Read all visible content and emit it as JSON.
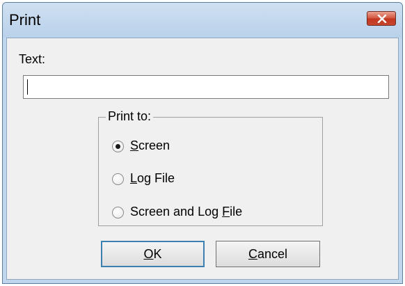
{
  "window": {
    "title": "Print"
  },
  "text_field": {
    "label": "Text:",
    "value": ""
  },
  "print_to": {
    "legend": "Print to:",
    "options": [
      {
        "mnemonic": "S",
        "rest": "creen",
        "selected": true
      },
      {
        "mnemonic": "L",
        "rest": "og File",
        "selected": false
      },
      {
        "prefix": "Screen and Log ",
        "mnemonic": "F",
        "rest": "ile",
        "selected": false
      }
    ]
  },
  "buttons": {
    "ok": {
      "mnemonic": "O",
      "rest": "K"
    },
    "cancel": {
      "mnemonic": "C",
      "rest": "ancel"
    }
  },
  "colors": {
    "close_button": "#c8482f",
    "default_button_border": "#3c7fb1",
    "client_bg": "#f0f0f0"
  }
}
